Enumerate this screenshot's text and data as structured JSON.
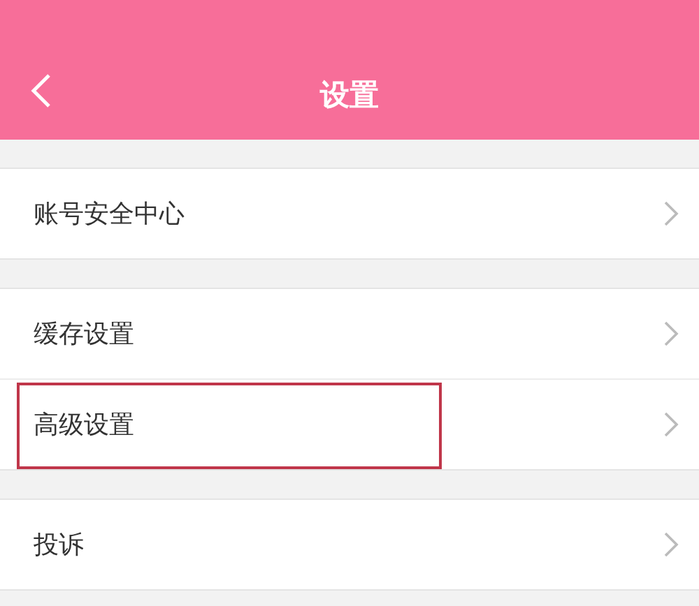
{
  "header": {
    "title": "设置"
  },
  "groups": [
    {
      "items": [
        {
          "label": "账号安全中心",
          "highlighted": false
        }
      ]
    },
    {
      "items": [
        {
          "label": "缓存设置",
          "highlighted": false
        },
        {
          "label": "高级设置",
          "highlighted": true
        }
      ]
    },
    {
      "items": [
        {
          "label": "投诉",
          "highlighted": false
        }
      ]
    }
  ]
}
